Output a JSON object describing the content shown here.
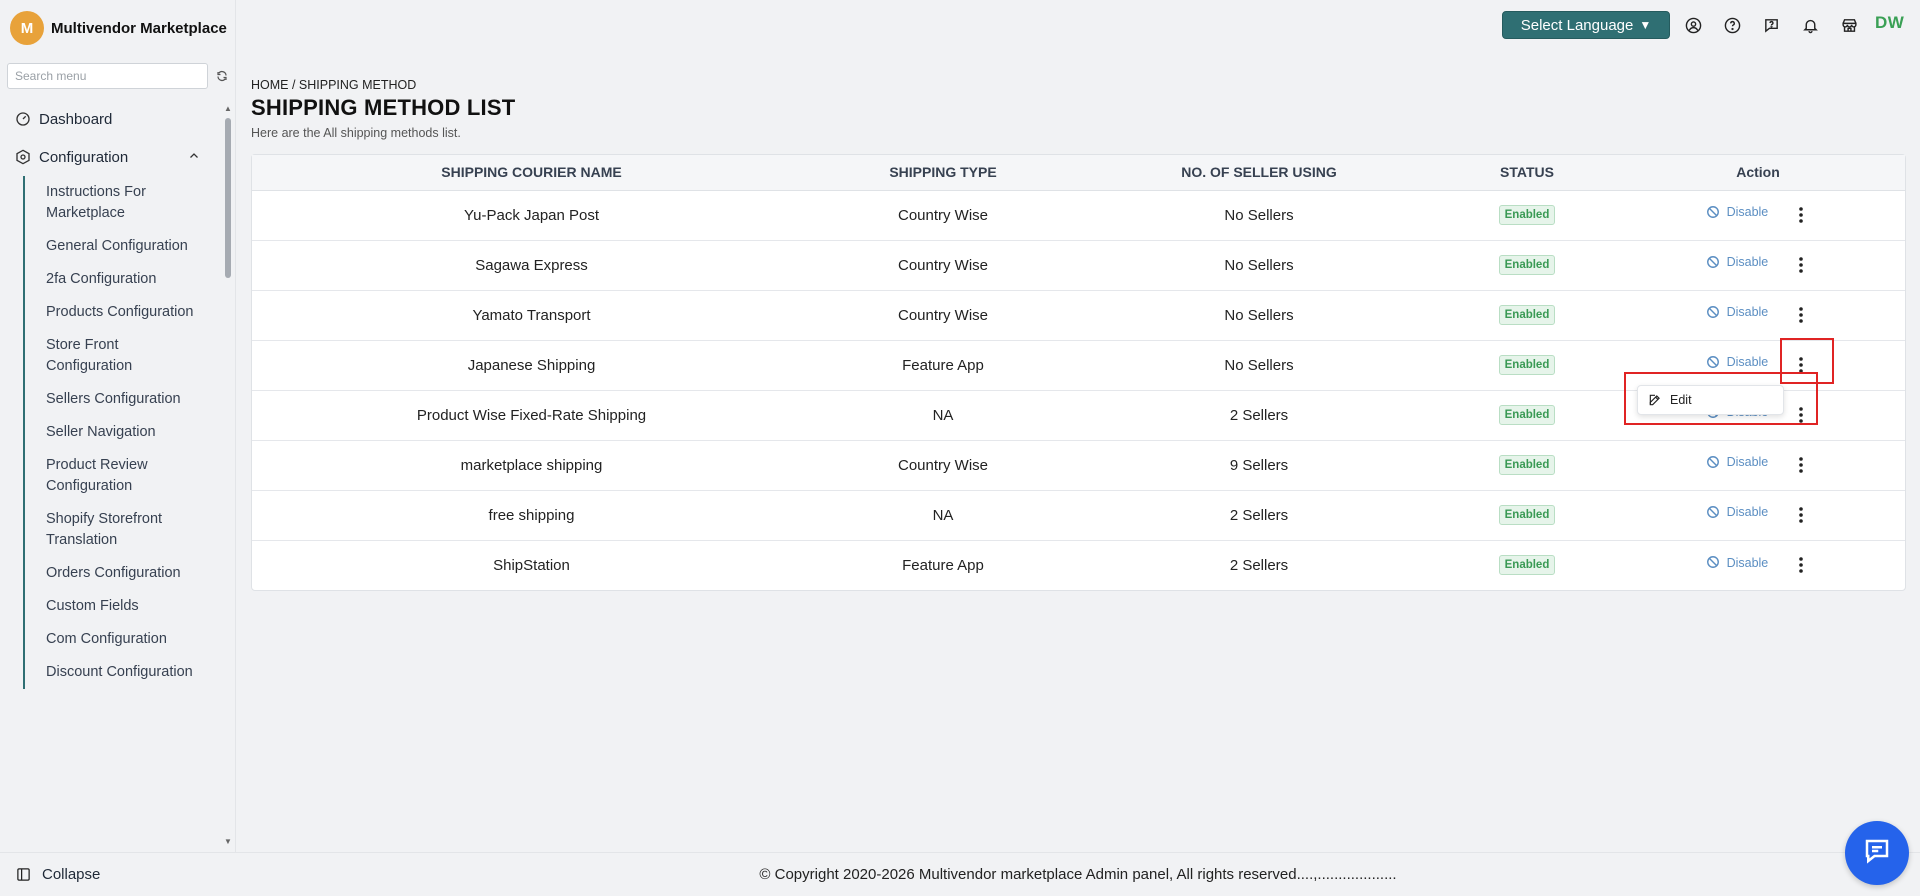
{
  "brand": {
    "logo_letter": "M",
    "name": "Multivendor Marketplace"
  },
  "sidebar": {
    "search_placeholder": "Search menu",
    "dashboard_label": "Dashboard",
    "configuration_label": "Configuration",
    "items": [
      "Instructions For Marketplace",
      "General Configuration",
      "2fa Configuration",
      "Products Configuration",
      "Store Front Configuration",
      "Sellers Configuration",
      "Seller Navigation",
      "Product Review Configuration",
      "Shopify Storefront Translation",
      "Orders Configuration",
      "Custom Fields",
      "Com Configuration",
      "Discount Configuration"
    ],
    "collapse_label": "Collapse"
  },
  "topbar": {
    "language_label": "Select Language",
    "avatar_initials": "DW"
  },
  "page": {
    "breadcrumb": "HOME / SHIPPING METHOD",
    "title": "SHIPPING METHOD LIST",
    "subtitle": "Here are the All shipping methods list."
  },
  "table": {
    "headers": [
      "SHIPPING COURIER NAME",
      "SHIPPING TYPE",
      "NO. OF SELLER USING",
      "STATUS",
      "Action"
    ],
    "rows": [
      {
        "name": "Yu-Pack Japan Post",
        "type": "Country Wise",
        "sellers": "No Sellers",
        "status": "Enabled",
        "action": "Disable"
      },
      {
        "name": "Sagawa Express",
        "type": "Country Wise",
        "sellers": "No Sellers",
        "status": "Enabled",
        "action": "Disable"
      },
      {
        "name": "Yamato Transport",
        "type": "Country Wise",
        "sellers": "No Sellers",
        "status": "Enabled",
        "action": "Disable"
      },
      {
        "name": "Japanese Shipping",
        "type": "Feature App",
        "sellers": "No Sellers",
        "status": "Enabled",
        "action": "Disable"
      },
      {
        "name": "Product Wise Fixed-Rate Shipping",
        "type": "NA",
        "sellers": "2 Sellers",
        "status": "Enabled",
        "action": "Disable"
      },
      {
        "name": "marketplace shipping",
        "type": "Country Wise",
        "sellers": "9 Sellers",
        "status": "Enabled",
        "action": "Disable"
      },
      {
        "name": "free shipping",
        "type": "NA",
        "sellers": "2 Sellers",
        "status": "Enabled",
        "action": "Disable"
      },
      {
        "name": "ShipStation",
        "type": "Feature App",
        "sellers": "2 Sellers",
        "status": "Enabled",
        "action": "Disable"
      }
    ]
  },
  "dropdown": {
    "edit_label": "Edit"
  },
  "footer": {
    "copyright": "© Copyright 2020-2026 Multivendor marketplace Admin panel, All rights reserved....,..................."
  },
  "colors": {
    "accent": "#2f6f73",
    "status_green": "#3a9a55",
    "link_blue": "#5b8ec2",
    "highlight_red": "#e02424",
    "chat_blue": "#2563eb"
  }
}
